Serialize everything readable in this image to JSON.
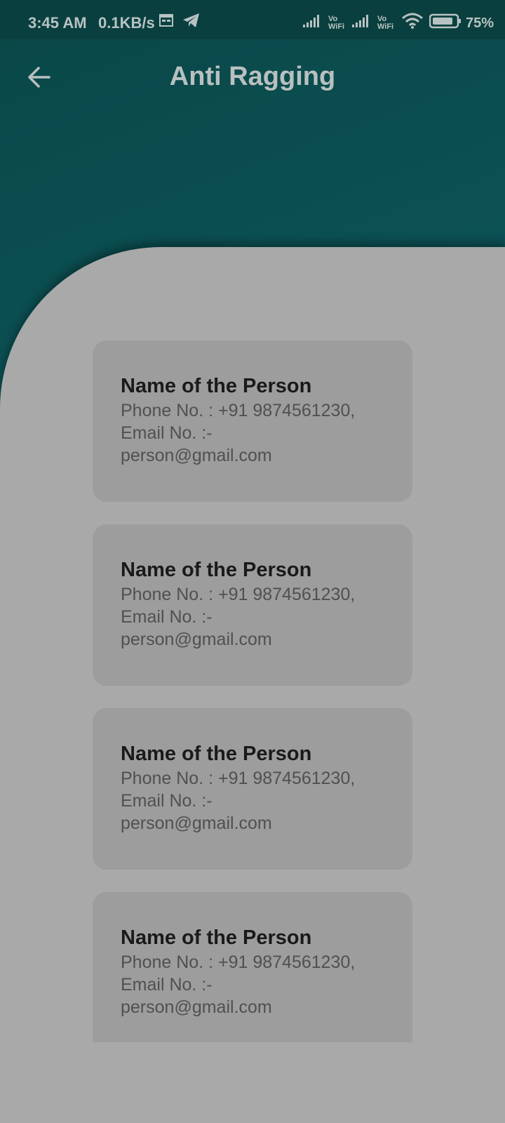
{
  "status_bar": {
    "time": "3:45 AM",
    "speed": "0.1KB/s",
    "battery": "75%",
    "icons": [
      "calendar-icon",
      "telegram-icon",
      "signal-icon",
      "vowifi-icon",
      "signal-icon",
      "vowifi-icon",
      "wifi-icon",
      "battery-icon"
    ]
  },
  "header": {
    "title": "Anti Ragging",
    "back_icon": "arrow-left-icon"
  },
  "contacts": [
    {
      "name": "Name of the Person",
      "phone": "Phone No. : +91 9874561230,",
      "email_label": "Email No. :-",
      "email": "person@gmail.com"
    },
    {
      "name": "Name of the Person",
      "phone": "Phone No. : +91 9874561230,",
      "email_label": "Email No. :-",
      "email": "person@gmail.com"
    },
    {
      "name": "Name of the Person",
      "phone": "Phone No. : +91 9874561230,",
      "email_label": "Email No. :-",
      "email": "person@gmail.com"
    },
    {
      "name": "Name of the Person",
      "phone": "Phone No. : +91 9874561230,",
      "email_label": "Email No. :-",
      "email": "person@gmail.com"
    }
  ],
  "colors": {
    "header_gradient_start": "#0a4747",
    "header_gradient_end": "#1a3d5e",
    "sheet_background": "#a9a9a9",
    "card_background": "#9d9d9d",
    "name_text": "#1a1a1a",
    "detail_text": "#505050"
  }
}
